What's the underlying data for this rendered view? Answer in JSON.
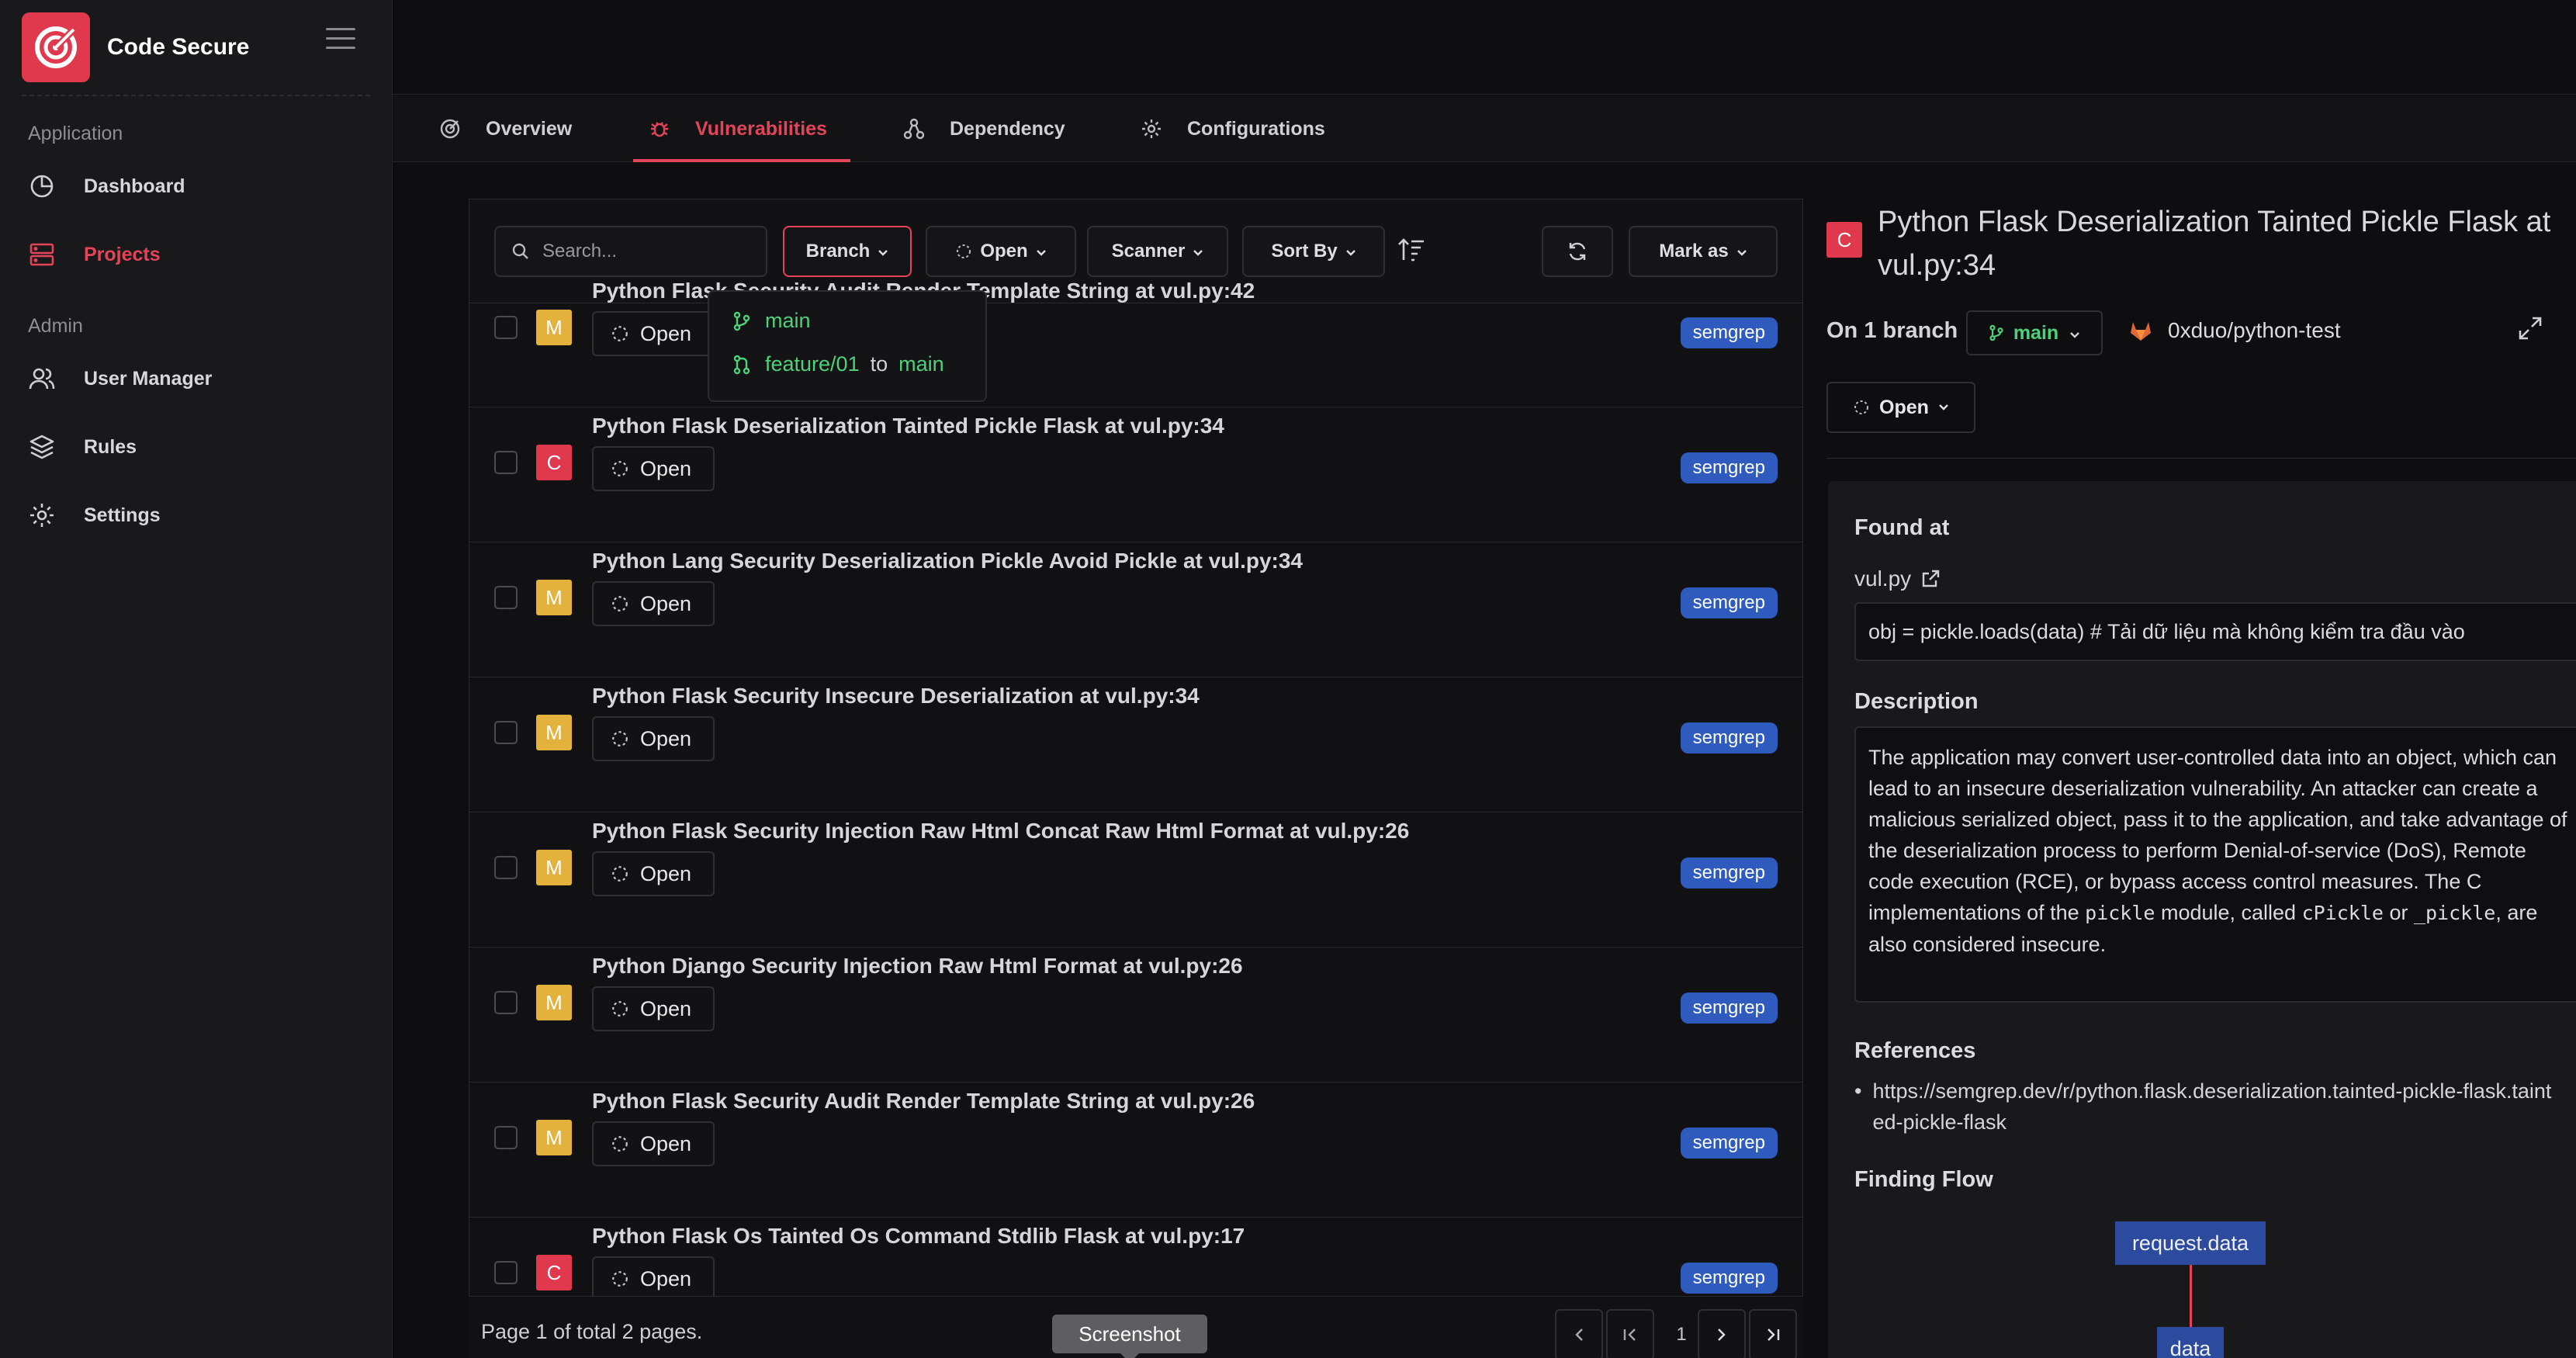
{
  "app": {
    "name": "Code Secure"
  },
  "sidebar": {
    "sections": [
      {
        "label": "Application"
      },
      {
        "label": "Admin"
      }
    ],
    "items": [
      {
        "label": "Dashboard",
        "icon": "dashboard-icon"
      },
      {
        "label": "Projects",
        "icon": "projects-icon",
        "active": true
      },
      {
        "label": "User Manager",
        "icon": "users-icon"
      },
      {
        "label": "Rules",
        "icon": "layers-icon"
      },
      {
        "label": "Settings",
        "icon": "gear-icon"
      }
    ]
  },
  "tabs": [
    {
      "label": "Overview",
      "icon": "overview-icon"
    },
    {
      "label": "Vulnerabilities",
      "icon": "bug-icon",
      "active": true
    },
    {
      "label": "Dependency",
      "icon": "dependency-icon"
    },
    {
      "label": "Configurations",
      "icon": "gear-icon"
    }
  ],
  "toolbar": {
    "search_placeholder": "Search...",
    "branch": "Branch",
    "status": "Open",
    "scanner": "Scanner",
    "sort": "Sort By",
    "mark_as": "Mark as"
  },
  "branch_dropdown": {
    "items": [
      {
        "label": "main"
      },
      {
        "source": "feature/01",
        "to": "to",
        "target": "main"
      }
    ]
  },
  "findings": [
    {
      "severity": "M",
      "title": "Python Flask Security Audit Render Template String at vul.py:42",
      "status": "Open",
      "scanner": "semgrep"
    },
    {
      "severity": "C",
      "title": "Python Flask Deserialization Tainted Pickle Flask at vul.py:34",
      "status": "Open",
      "scanner": "semgrep"
    },
    {
      "severity": "M",
      "title": "Python Lang Security Deserialization Pickle Avoid Pickle at vul.py:34",
      "status": "Open",
      "scanner": "semgrep"
    },
    {
      "severity": "M",
      "title": "Python Flask Security Insecure Deserialization at vul.py:34",
      "status": "Open",
      "scanner": "semgrep"
    },
    {
      "severity": "M",
      "title": "Python Flask Security Injection Raw Html Concat Raw Html Format at vul.py:26",
      "status": "Open",
      "scanner": "semgrep"
    },
    {
      "severity": "M",
      "title": "Python Django Security Injection Raw Html Format at vul.py:26",
      "status": "Open",
      "scanner": "semgrep"
    },
    {
      "severity": "M",
      "title": "Python Flask Security Audit Render Template String at vul.py:26",
      "status": "Open",
      "scanner": "semgrep"
    },
    {
      "severity": "C",
      "title": "Python Flask Os Tainted Os Command Stdlib Flask at vul.py:17",
      "status": "Open",
      "scanner": "semgrep"
    }
  ],
  "severity_colors": {
    "M": "#e3b23c",
    "C": "#e0394d"
  },
  "pagination": {
    "info": "Page 1 of total 2 pages.",
    "current": "1"
  },
  "tooltip": "Screenshot",
  "detail": {
    "severity": "C",
    "title": "Python Flask Deserialization Tainted Pickle Flask at vul.py:34",
    "branch_label": "On 1 branch",
    "branch": "main",
    "repo": "0xduo/python-test",
    "status": "Open",
    "found_at_heading": "Found at",
    "file": "vul.py",
    "code": "obj = pickle.loads(data) # Tải dữ liệu mà không kiểm tra đầu vào",
    "description_heading": "Description",
    "description_part1": "The application may convert user-controlled data into an object, which can lead to an insecure deserialization vulnerability. An attacker can create a malicious serialized object, pass it to the application, and take advantage of the deserialization process to perform Denial-of-service (DoS), Remote code execution (RCE), or bypass access control measures. The C implementations of the ",
    "description_code1": "pickle",
    "description_part2": " module, called ",
    "description_code2": "cPickle",
    "description_part3": " or ",
    "description_code3": "_pickle",
    "description_part4": ", are also considered insecure.",
    "references_heading": "References",
    "references": [
      "https://semgrep.dev/r/python.flask.deserialization.tainted-pickle-flask.tainted-pickle-flask"
    ],
    "flow_heading": "Finding Flow",
    "flow": [
      "request.data",
      "data"
    ]
  }
}
